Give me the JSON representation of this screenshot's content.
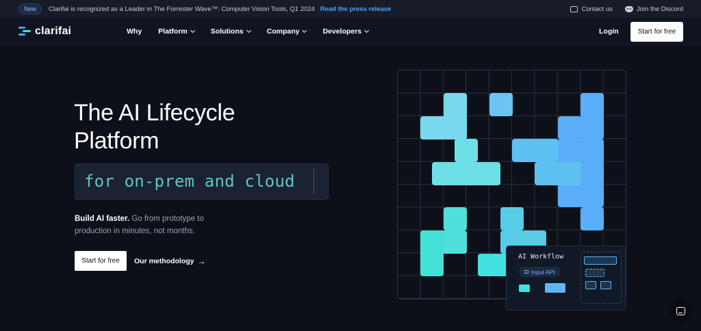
{
  "announcement": {
    "badge": "New",
    "text": "Clarifai is recognized as a Leader in The Forrester Wave™: Computer Vision Tools, Q1 2024",
    "link": "Read the press release",
    "contact": "Contact us",
    "discord": "Join the Discord"
  },
  "nav": {
    "brand": "clarifai",
    "items": [
      {
        "label": "Why",
        "dropdown": false
      },
      {
        "label": "Platform",
        "dropdown": true
      },
      {
        "label": "Solutions",
        "dropdown": true
      },
      {
        "label": "Company",
        "dropdown": true
      },
      {
        "label": "Developers",
        "dropdown": true
      }
    ],
    "login": "Login",
    "start": "Start for free"
  },
  "hero": {
    "title_line1": "The AI Lifecycle",
    "title_line2": "Platform",
    "typed": "for on-prem and cloud",
    "sub_bold": "Build AI faster.",
    "sub_rest": " Go from prototype to production in minutes, not months.",
    "cta": "Start for free",
    "secondary": "Our methodology",
    "secondary_arrow": "→"
  },
  "workflow": {
    "title": "AI Workflow",
    "pill": "Input API"
  },
  "colors": {
    "accent_cyan": "#43e0e0",
    "accent_blue": "#5fb5f5",
    "link": "#4aa3ff"
  }
}
